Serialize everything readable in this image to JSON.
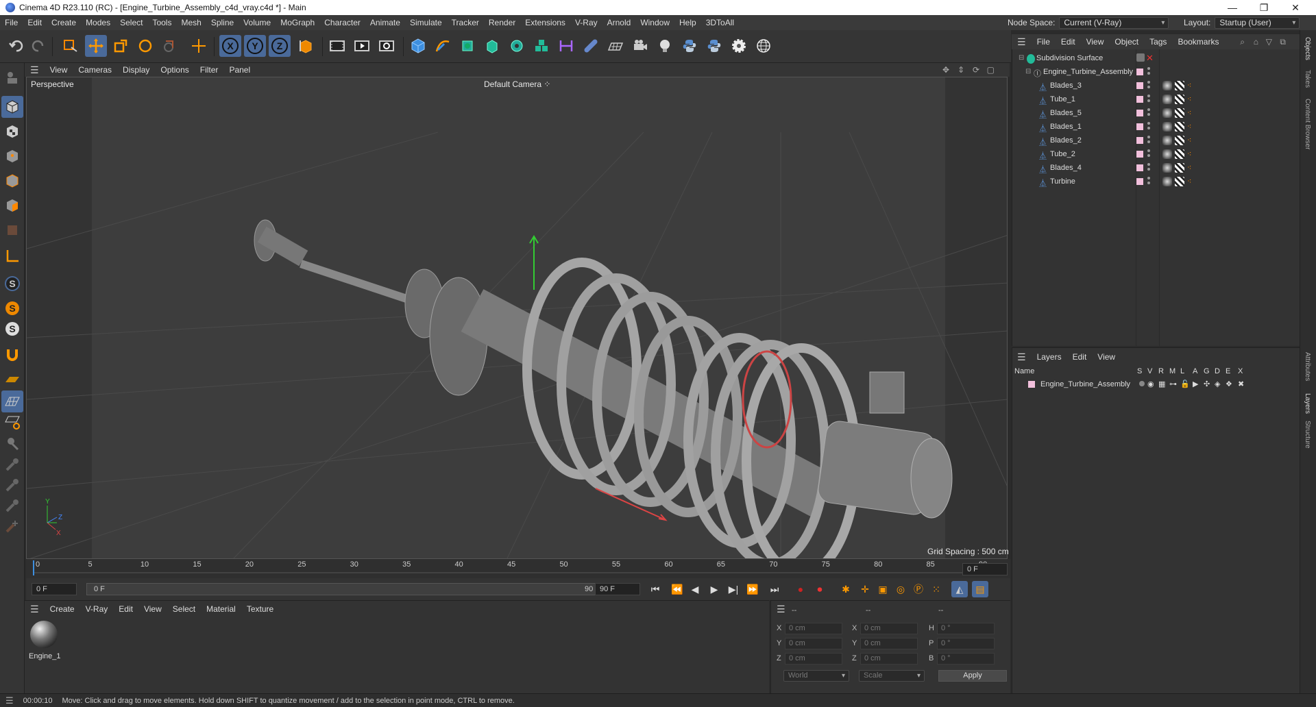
{
  "window": {
    "title": "Cinema 4D R23.110 (RC) - [Engine_Turbine_Assembly_c4d_vray.c4d *] - Main",
    "controls": [
      "minimize",
      "maximize",
      "close"
    ]
  },
  "menubar": {
    "items": [
      "File",
      "Edit",
      "Create",
      "Modes",
      "Select",
      "Tools",
      "Mesh",
      "Spline",
      "Volume",
      "MoGraph",
      "Character",
      "Animate",
      "Simulate",
      "Tracker",
      "Render",
      "Extensions",
      "V-Ray",
      "Arnold",
      "Window",
      "Help",
      "3DToAll"
    ],
    "node_space_label": "Node Space:",
    "node_space_value": "Current (V-Ray)",
    "layout_label": "Layout:",
    "layout_value": "Startup (User)"
  },
  "viewport": {
    "menu": [
      "View",
      "Cameras",
      "Display",
      "Options",
      "Filter",
      "Panel"
    ],
    "view_name": "Perspective",
    "camera": "Default Camera",
    "grid_spacing": "Grid Spacing : 500 cm",
    "axis_labels": {
      "y": "Y",
      "z": "Z",
      "x": "X"
    }
  },
  "timeline": {
    "ticks": [
      "0",
      "5",
      "10",
      "15",
      "20",
      "25",
      "30",
      "35",
      "40",
      "45",
      "50",
      "55",
      "60",
      "65",
      "70",
      "75",
      "80",
      "85",
      "90"
    ],
    "current_frame_right": "0 F",
    "start_field": "0 F",
    "range_start": "0 F",
    "range_end": "90 F",
    "end_field": "90 F"
  },
  "materials": {
    "menu": [
      "Create",
      "V-Ray",
      "Edit",
      "View",
      "Select",
      "Material",
      "Texture"
    ],
    "items": [
      {
        "name": "Engine_1"
      }
    ]
  },
  "coordinates": {
    "header_dashes": [
      "--",
      "--",
      "--"
    ],
    "rows": [
      {
        "pos_label": "X",
        "pos": "0 cm",
        "size_label": "X",
        "size": "0 cm",
        "rot_label": "H",
        "rot": "0 °"
      },
      {
        "pos_label": "Y",
        "pos": "0 cm",
        "size_label": "Y",
        "size": "0 cm",
        "rot_label": "P",
        "rot": "0 °"
      },
      {
        "pos_label": "Z",
        "pos": "0 cm",
        "size_label": "Z",
        "size": "0 cm",
        "rot_label": "B",
        "rot": "0 °"
      }
    ],
    "mode": "World",
    "scale": "Scale",
    "apply": "Apply"
  },
  "objects": {
    "menu": [
      "File",
      "Edit",
      "View",
      "Object",
      "Tags",
      "Bookmarks"
    ],
    "tree": [
      {
        "name": "Subdivision Surface",
        "level": 0,
        "type": "subdiv"
      },
      {
        "name": "Engine_Turbine_Assembly",
        "level": 1,
        "type": "null"
      },
      {
        "name": "Blades_3",
        "level": 2,
        "type": "mesh"
      },
      {
        "name": "Tube_1",
        "level": 2,
        "type": "mesh"
      },
      {
        "name": "Blades_5",
        "level": 2,
        "type": "mesh"
      },
      {
        "name": "Blades_1",
        "level": 2,
        "type": "mesh"
      },
      {
        "name": "Blades_2",
        "level": 2,
        "type": "mesh"
      },
      {
        "name": "Tube_2",
        "level": 2,
        "type": "mesh"
      },
      {
        "name": "Blades_4",
        "level": 2,
        "type": "mesh"
      },
      {
        "name": "Turbine",
        "level": 2,
        "type": "mesh"
      }
    ]
  },
  "layers": {
    "menu": [
      "Layers",
      "Edit",
      "View"
    ],
    "columns": [
      "Name",
      "S",
      "V",
      "R",
      "M",
      "L",
      "A",
      "G",
      "D",
      "E",
      "X"
    ],
    "items": [
      {
        "name": "Engine_Turbine_Assembly",
        "color": "#f2c0dc"
      }
    ]
  },
  "side_tabs": [
    "Objects",
    "Takes",
    "Content Browser",
    "Attributes",
    "Layers",
    "Structure"
  ],
  "status": {
    "time": "00:00:10",
    "message": "Move: Click and drag to move elements. Hold down SHIFT to quantize movement / add to the selection in point mode, CTRL to remove."
  },
  "colors": {
    "accent": "#3d8fe0",
    "layer_color": "#f2c0dc",
    "axis_x": "#d44",
    "axis_y": "#3c3",
    "axis_z": "#48f"
  }
}
